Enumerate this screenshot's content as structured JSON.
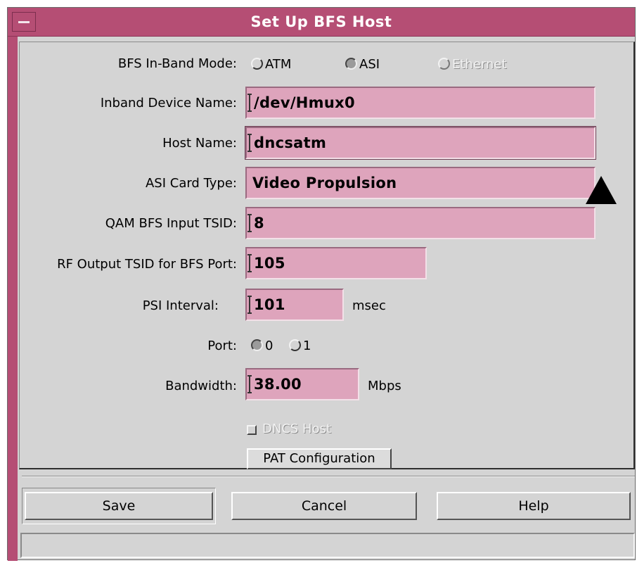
{
  "window": {
    "title": "Set Up BFS Host"
  },
  "form": {
    "bfs_mode": {
      "label": "BFS In-Band Mode:",
      "options": [
        {
          "label": "ATM",
          "selected": false,
          "enabled": true
        },
        {
          "label": "ASI",
          "selected": true,
          "enabled": true
        },
        {
          "label": "Ethernet",
          "selected": false,
          "enabled": false
        }
      ]
    },
    "inband_device": {
      "label": "Inband Device Name:",
      "value": "/dev/Hmux0"
    },
    "host_name": {
      "label": "Host Name:",
      "value": "dncsatm"
    },
    "asi_card_type": {
      "label": "ASI Card Type:",
      "value": "Video Propulsion"
    },
    "qam_tsid": {
      "label": "QAM BFS Input TSID:",
      "value": "8"
    },
    "rf_tsid": {
      "label": "RF Output TSID for BFS Port:",
      "value": "105"
    },
    "psi_interval": {
      "label": "PSI Interval:",
      "value": "101",
      "unit": "msec"
    },
    "port": {
      "label": "Port:",
      "options": [
        {
          "label": "0",
          "selected": true
        },
        {
          "label": "1",
          "selected": false
        }
      ]
    },
    "bandwidth": {
      "label": "Bandwidth:",
      "value": "38.00",
      "unit": "Mbps"
    },
    "dncs_host": {
      "label": "DNCS Host",
      "checked": false,
      "enabled": false
    },
    "pat_button": "PAT Configuration"
  },
  "buttons": {
    "save": "Save",
    "cancel": "Cancel",
    "help": "Help"
  },
  "status": {
    "text": ""
  },
  "colors": {
    "titlebar": "#b54e74",
    "field": "#dea4bc",
    "background": "#d4d4d4"
  }
}
